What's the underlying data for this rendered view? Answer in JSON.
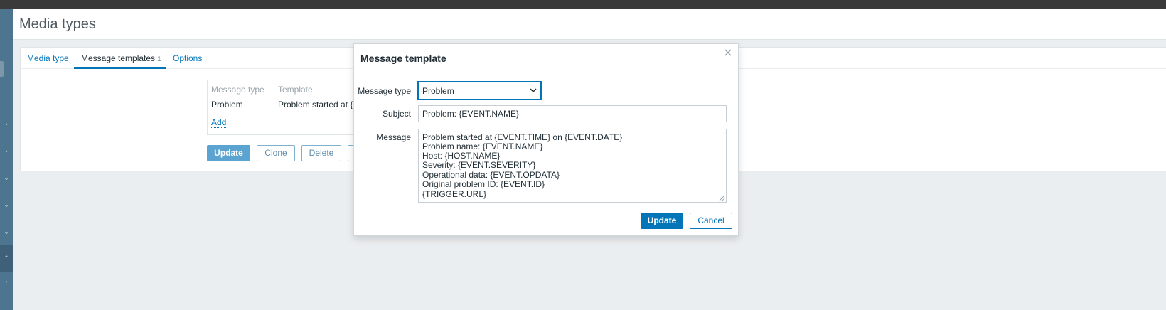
{
  "page": {
    "title": "Media types"
  },
  "tabs": [
    {
      "label": "Media type"
    },
    {
      "label": "Message templates",
      "count": "1"
    },
    {
      "label": "Options"
    }
  ],
  "templates_table": {
    "columns": [
      "Message type",
      "Template"
    ],
    "rows": [
      {
        "message_type": "Problem",
        "template": "Problem started at {EVENT.TIME} on {EVENT.DATE}"
      }
    ],
    "add_label": "Add"
  },
  "form_buttons": {
    "update": "Update",
    "clone": "Clone",
    "delete": "Delete"
  },
  "dialog": {
    "title": "Message template",
    "fields": {
      "message_type": {
        "label": "Message type",
        "value": "Problem"
      },
      "subject": {
        "label": "Subject",
        "value": "Problem: {EVENT.NAME}"
      },
      "message": {
        "label": "Message",
        "lines": [
          "Problem started at {EVENT.TIME} on {EVENT.DATE}",
          "Problem name: {EVENT.NAME}",
          "Host: {HOST.NAME}",
          "Severity: {EVENT.SEVERITY}",
          "Operational data: {EVENT.OPDATA}",
          "Original problem ID: {EVENT.ID}",
          "{TRIGGER.URL}"
        ]
      }
    },
    "buttons": {
      "update": "Update",
      "cancel": "Cancel"
    }
  },
  "icons": {
    "close": "close-icon",
    "select_chevron": "chevron-down-icon",
    "resize": "resize-grip-icon",
    "sidebar_chevron": "chevron-down-icon"
  },
  "colors": {
    "accent": "#0275b8",
    "sidebar": "#4d7590",
    "topbar": "#3a3a3a",
    "background": "#ebeef0"
  }
}
